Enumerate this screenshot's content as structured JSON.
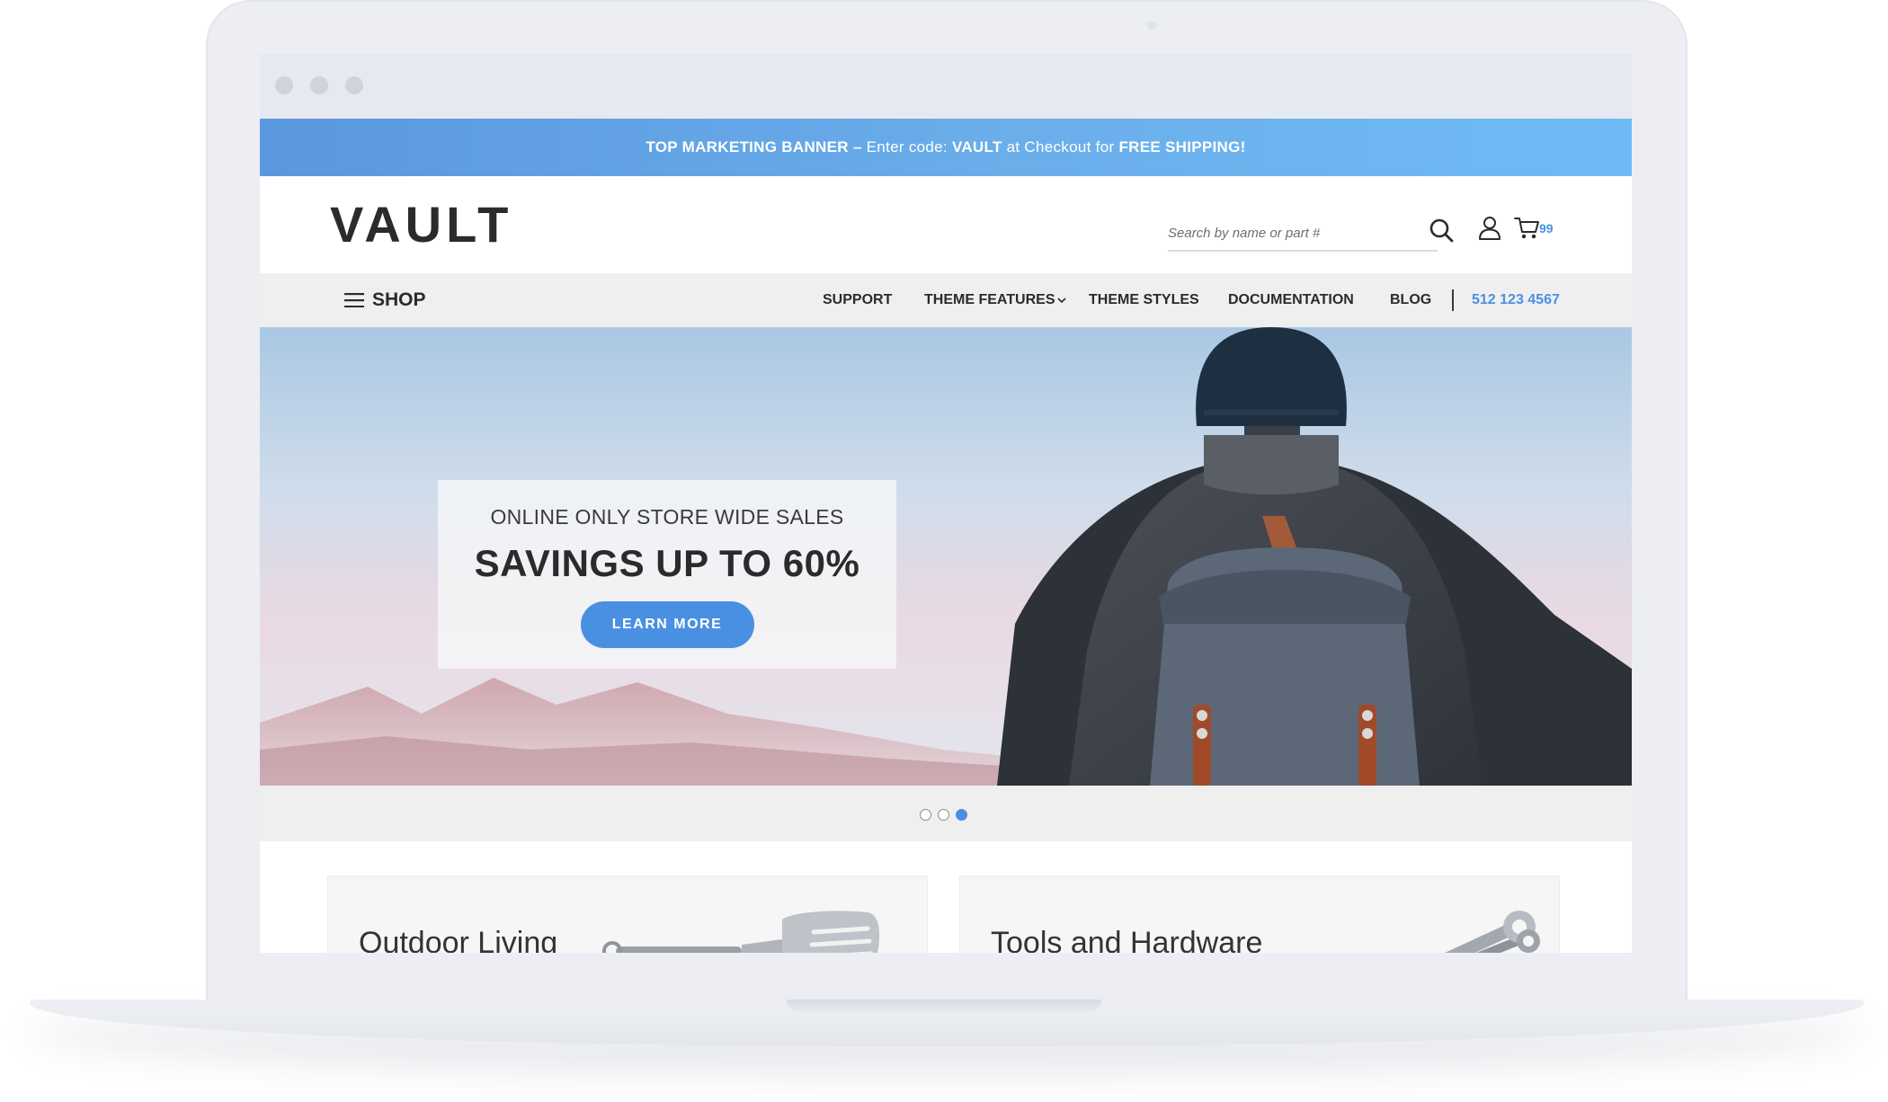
{
  "banner": {
    "label": "TOP MARKETING BANNER",
    "separator": "–",
    "text_prefix": "Enter code:",
    "code": "VAULT",
    "text_middle": "at Checkout for",
    "offer": "FREE SHIPPING!"
  },
  "header": {
    "logo": "VAULT",
    "search_placeholder": "Search by name or part #",
    "cart_count": "99"
  },
  "nav": {
    "shop_label": "SHOP",
    "items": [
      "SUPPORT",
      "THEME FEATURES",
      "THEME STYLES",
      "DOCUMENTATION",
      "BLOG"
    ],
    "phone": "512 123 4567"
  },
  "hero": {
    "subtitle": "ONLINE ONLY STORE WIDE SALES",
    "title": "SAVINGS UP TO 60%",
    "button_label": "LEARN MORE",
    "slides": 3,
    "active_slide": 3
  },
  "categories": [
    {
      "label": "Outdoor Living",
      "icon": "spatula-icon"
    },
    {
      "label": "Tools and Hardware",
      "icon": "wrench-set-icon"
    }
  ],
  "colors": {
    "accent": "#4a90e2",
    "banner_start": "#5a97de",
    "banner_end": "#6fbbf6",
    "text_dark": "#2b2b2b",
    "nav_bg": "#efefef"
  }
}
